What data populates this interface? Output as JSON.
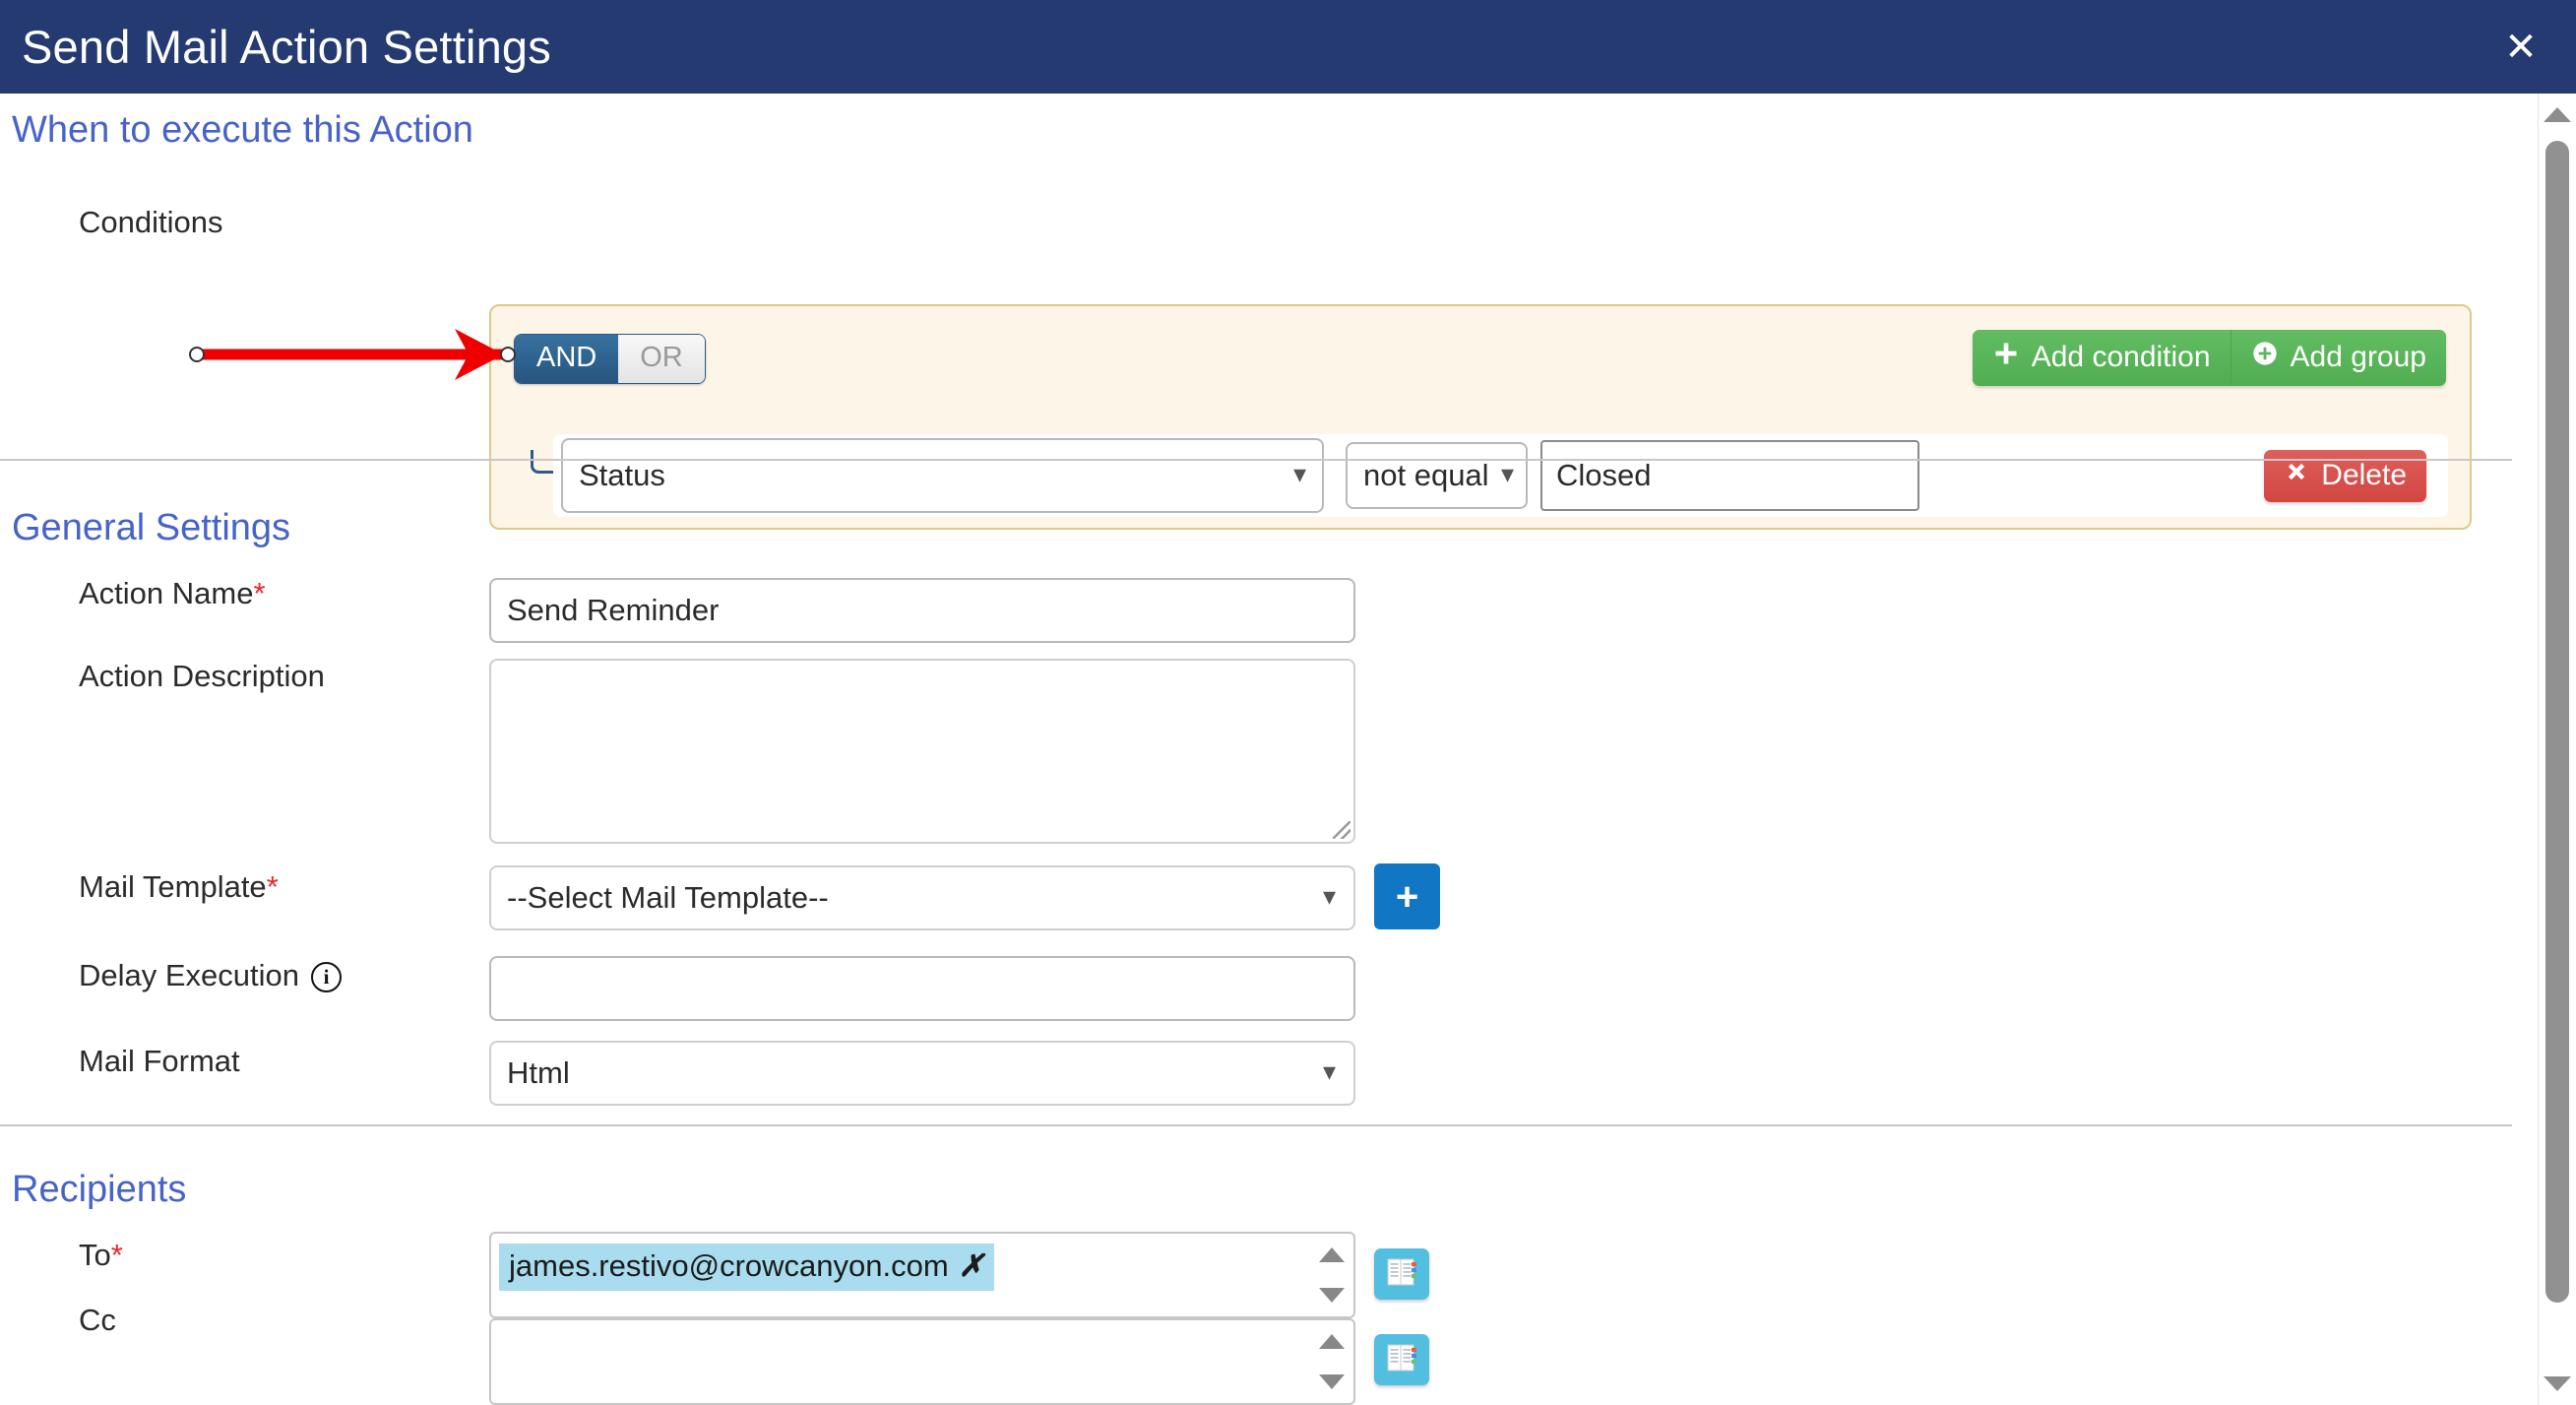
{
  "window": {
    "title": "Send Mail Action Settings",
    "close_label": "✕",
    "header_color": "#243a70"
  },
  "sections": {
    "when": "When to execute this Action",
    "general": "General Settings",
    "recipients": "Recipients"
  },
  "conditions": {
    "label": "Conditions",
    "logic": {
      "and": "AND",
      "or": "OR",
      "selected": "AND"
    },
    "add_condition": "Add condition",
    "add_group": "Add group",
    "add_condition_icon": "plus-icon",
    "add_group_icon": "circle-plus-icon",
    "delete": "Delete",
    "delete_icon": "x-mark-icon",
    "row": {
      "field": "Status",
      "operator": "not equal",
      "value": "Closed"
    },
    "panel_bg": "#fdf6e8",
    "panel_border": "#dfc98a"
  },
  "general": {
    "action_name": {
      "label": "Action Name",
      "required": "*",
      "value": "Send Reminder"
    },
    "action_description": {
      "label": "Action Description",
      "value": ""
    },
    "mail_template": {
      "label": "Mail Template",
      "required": "*",
      "value": "--Select Mail Template--",
      "add_button": "+"
    },
    "delay_execution": {
      "label": "Delay Execution",
      "value": "",
      "info_icon": "info-icon",
      "info_glyph": "i"
    },
    "mail_format": {
      "label": "Mail Format",
      "value": "Html"
    }
  },
  "recipients": {
    "to": {
      "label": "To",
      "required": "*",
      "chips": [
        {
          "text": "james.restivo@crowcanyon.com",
          "remove": "✗"
        }
      ],
      "picker_icon": "address-book-icon"
    },
    "cc": {
      "label": "Cc",
      "chips": [],
      "picker_icon": "address-book-icon"
    }
  },
  "annotation": {
    "type": "arrow",
    "color": "#ee0000",
    "points_to": "condition-row"
  },
  "scrollbar": {
    "up_icon": "caret-up-icon",
    "down_icon": "caret-down-icon"
  },
  "theme": {
    "heading_blue": "#4763c9",
    "green": "#5cb85c",
    "red": "#d9534f",
    "blue_button": "#1177c4",
    "chip_blue": "#a8dcee",
    "book_button": "#52bfe0"
  }
}
